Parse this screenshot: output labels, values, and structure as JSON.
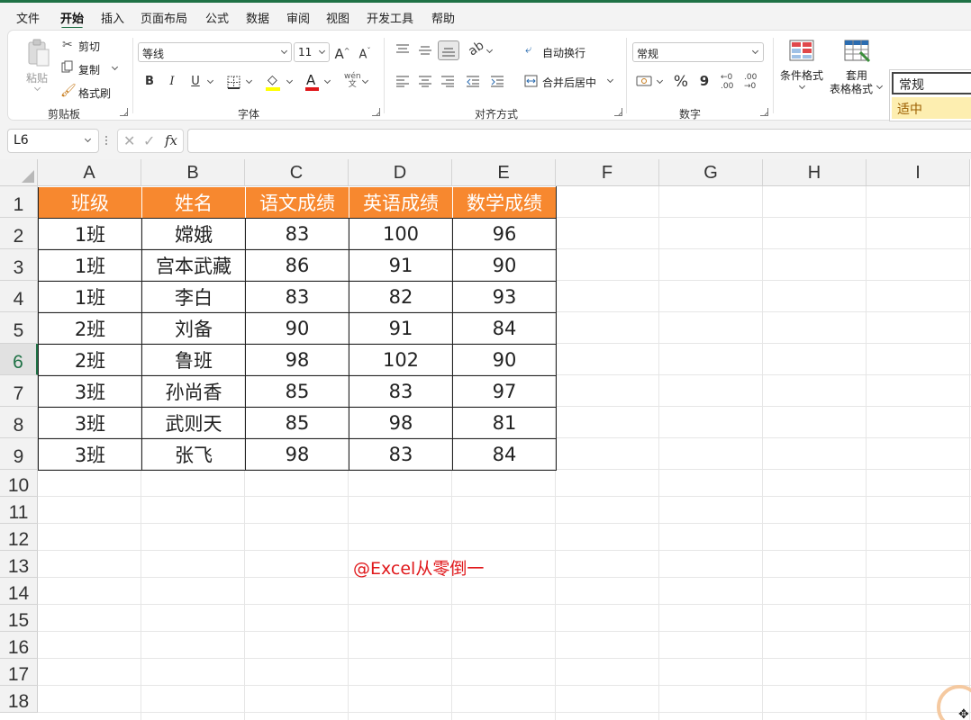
{
  "menu": {
    "tabs": [
      "文件",
      "开始",
      "插入",
      "页面布局",
      "公式",
      "数据",
      "审阅",
      "视图",
      "开发工具",
      "帮助"
    ],
    "active": "开始"
  },
  "ribbon": {
    "clipboard": {
      "paste": "粘贴",
      "cut": "剪切",
      "copy": "复制",
      "format_painter": "格式刷",
      "label": "剪贴板"
    },
    "font": {
      "name": "等线",
      "size": "11",
      "label": "字体",
      "bold": "B",
      "italic": "I",
      "underline": "U",
      "grow": "A",
      "shrink": "A",
      "color_glyph": "A",
      "phonetic": "wén\n文"
    },
    "alignment": {
      "wrap": "自动换行",
      "merge": "合并后居中",
      "label": "对齐方式"
    },
    "number": {
      "format": "常规",
      "label": "数字",
      "percent": "%",
      "comma": "9",
      "inc_decimal": "←0\n.00",
      "dec_decimal": ".00\n→0"
    },
    "styles": {
      "conditional": "条件格式",
      "table_line1": "套用",
      "table_line2": "表格格式",
      "normal": "常规",
      "neutral": "适中"
    }
  },
  "formula_bar": {
    "name_box": "L6",
    "fx": "fx",
    "cancel": "✕",
    "enter": "✓",
    "value": ""
  },
  "sheet": {
    "columns": [
      "A",
      "B",
      "C",
      "D",
      "E",
      "F",
      "G",
      "H",
      "I"
    ],
    "rows": [
      "1",
      "2",
      "3",
      "4",
      "5",
      "6",
      "7",
      "8",
      "9",
      "10",
      "11",
      "12",
      "13",
      "14",
      "15",
      "16",
      "17",
      "18"
    ],
    "selected_row": "6",
    "header": [
      "班级",
      "姓名",
      "语文成绩",
      "英语成绩",
      "数学成绩"
    ],
    "data": [
      [
        "1班",
        "嫦娥",
        "83",
        "100",
        "96"
      ],
      [
        "1班",
        "宫本武藏",
        "86",
        "91",
        "90"
      ],
      [
        "1班",
        "李白",
        "83",
        "82",
        "93"
      ],
      [
        "2班",
        "刘备",
        "90",
        "91",
        "84"
      ],
      [
        "2班",
        "鲁班",
        "98",
        "102",
        "90"
      ],
      [
        "3班",
        "孙尚香",
        "85",
        "83",
        "97"
      ],
      [
        "3班",
        "武则天",
        "85",
        "98",
        "81"
      ],
      [
        "3班",
        "张飞",
        "98",
        "83",
        "84"
      ]
    ],
    "watermark": "@Excel从零倒一"
  },
  "colors": {
    "accent": "#1e7145",
    "table_header": "#f7882f",
    "watermark": "#e0181b",
    "neutral_fill": "#fdeeb0"
  }
}
